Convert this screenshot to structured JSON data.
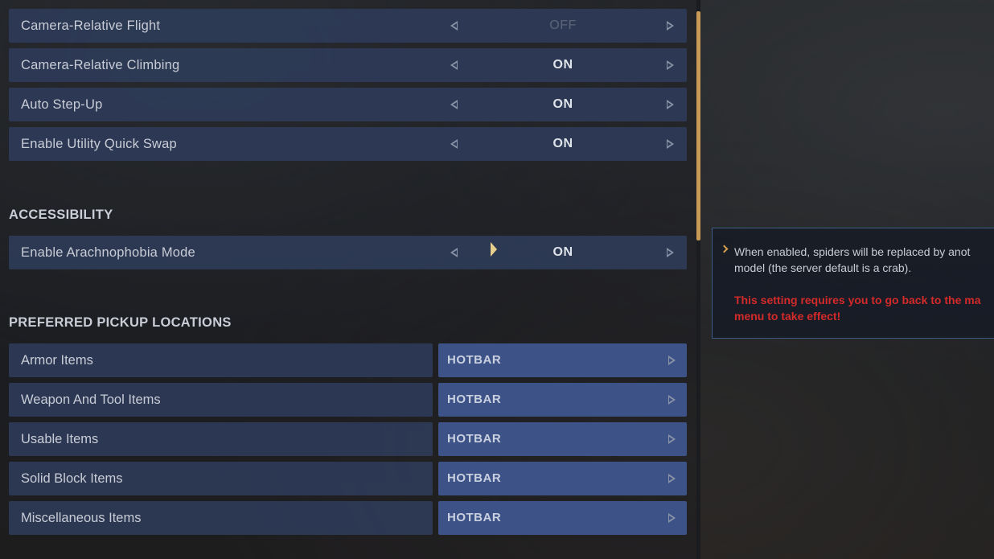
{
  "controls": [
    {
      "label": "Camera-Relative Flight",
      "value": "OFF"
    },
    {
      "label": "Camera-Relative Climbing",
      "value": "ON"
    },
    {
      "label": "Auto Step-Up",
      "value": "ON"
    },
    {
      "label": "Enable Utility Quick Swap",
      "value": "ON"
    }
  ],
  "accessibility": {
    "section_title": "ACCESSIBILITY",
    "arachnophobia": {
      "label": "Enable Arachnophobia Mode",
      "value": "ON"
    }
  },
  "pickup": {
    "section_title": "PREFERRED PICKUP LOCATIONS",
    "items": [
      {
        "label": "Armor Items",
        "value": "HOTBAR"
      },
      {
        "label": "Weapon And Tool Items",
        "value": "HOTBAR"
      },
      {
        "label": "Usable Items",
        "value": "HOTBAR"
      },
      {
        "label": "Solid Block Items",
        "value": "HOTBAR"
      },
      {
        "label": "Miscellaneous Items",
        "value": "HOTBAR"
      }
    ]
  },
  "tooltip": {
    "line1": "When enabled, spiders will be replaced by anot",
    "line2": "model (the server default is a crab).",
    "warn1": "This setting requires you to go back to the ma",
    "warn2": "menu to take effect!"
  },
  "colors": {
    "row_bg": "#2f3c5a",
    "select_bg": "#3d5286",
    "scroll_thumb": "#c89a55",
    "warning": "#d42a2a"
  },
  "icons": {
    "prev": "caret-left-icon",
    "next": "caret-right-icon",
    "tooltip_bullet": "chevron-right-icon",
    "cursor": "mouse-cursor-icon"
  }
}
